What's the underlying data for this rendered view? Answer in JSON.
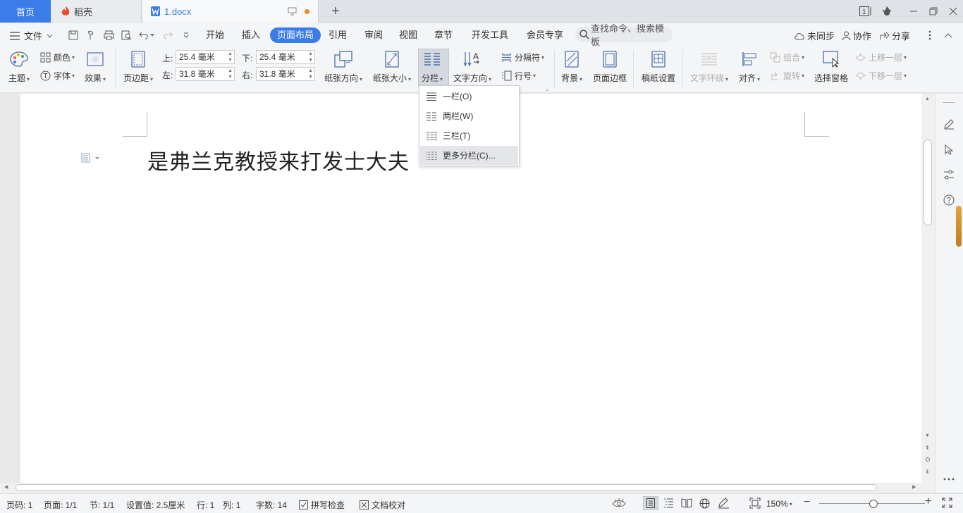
{
  "tabs": {
    "home": "首页",
    "daoke": "稻壳",
    "doc": "1.docx"
  },
  "menu": {
    "file": "文件",
    "items": [
      "开始",
      "插入",
      "页面布局",
      "引用",
      "审阅",
      "视图",
      "章节",
      "开发工具",
      "会员专享"
    ],
    "active_index": 2,
    "search_placeholder": "查找命令、搜索模板",
    "sync": "未同步",
    "collab": "协作",
    "share": "分享"
  },
  "ribbon": {
    "theme": "主题",
    "colors": "颜色",
    "fonts": "字体",
    "effects": "效果",
    "margins": "页边距",
    "margin_top_label": "上:",
    "margin_top_value": "25.4 毫米",
    "margin_bottom_label": "下:",
    "margin_bottom_value": "25.4 毫米",
    "margin_left_label": "左:",
    "margin_left_value": "31.8 毫米",
    "margin_right_label": "右:",
    "margin_right_value": "31.8 毫米",
    "orientation": "纸张方向",
    "size": "纸张大小",
    "columns": "分栏",
    "text_direction": "文字方向",
    "breaks": "分隔符",
    "line_numbers": "行号",
    "background": "背景",
    "page_border": "页面边框",
    "manuscript": "稿纸设置",
    "text_wrap": "文字环绕",
    "align": "对齐",
    "group": "组合",
    "rotate": "旋转",
    "selection_pane": "选择窗格",
    "bring_forward": "上移一层",
    "send_backward": "下移一层"
  },
  "columns_menu": {
    "items": [
      "一栏(O)",
      "两栏(W)",
      "三栏(T)",
      "更多分栏(C)..."
    ],
    "hover_index": 3
  },
  "document": {
    "text": "是弗兰克教授来打发士大夫"
  },
  "status": {
    "page_no": "页码: 1",
    "pages": "页面: 1/1",
    "section": "节: 1/1",
    "setting": "设置值: 2.5厘米",
    "row": "行: 1",
    "col": "列: 1",
    "words": "字数: 14",
    "spell": "拼写检查",
    "proof": "文档校对",
    "zoom": "150%"
  },
  "colors": {
    "accent": "#3b7de8",
    "tab_dot": "#f08a24"
  }
}
